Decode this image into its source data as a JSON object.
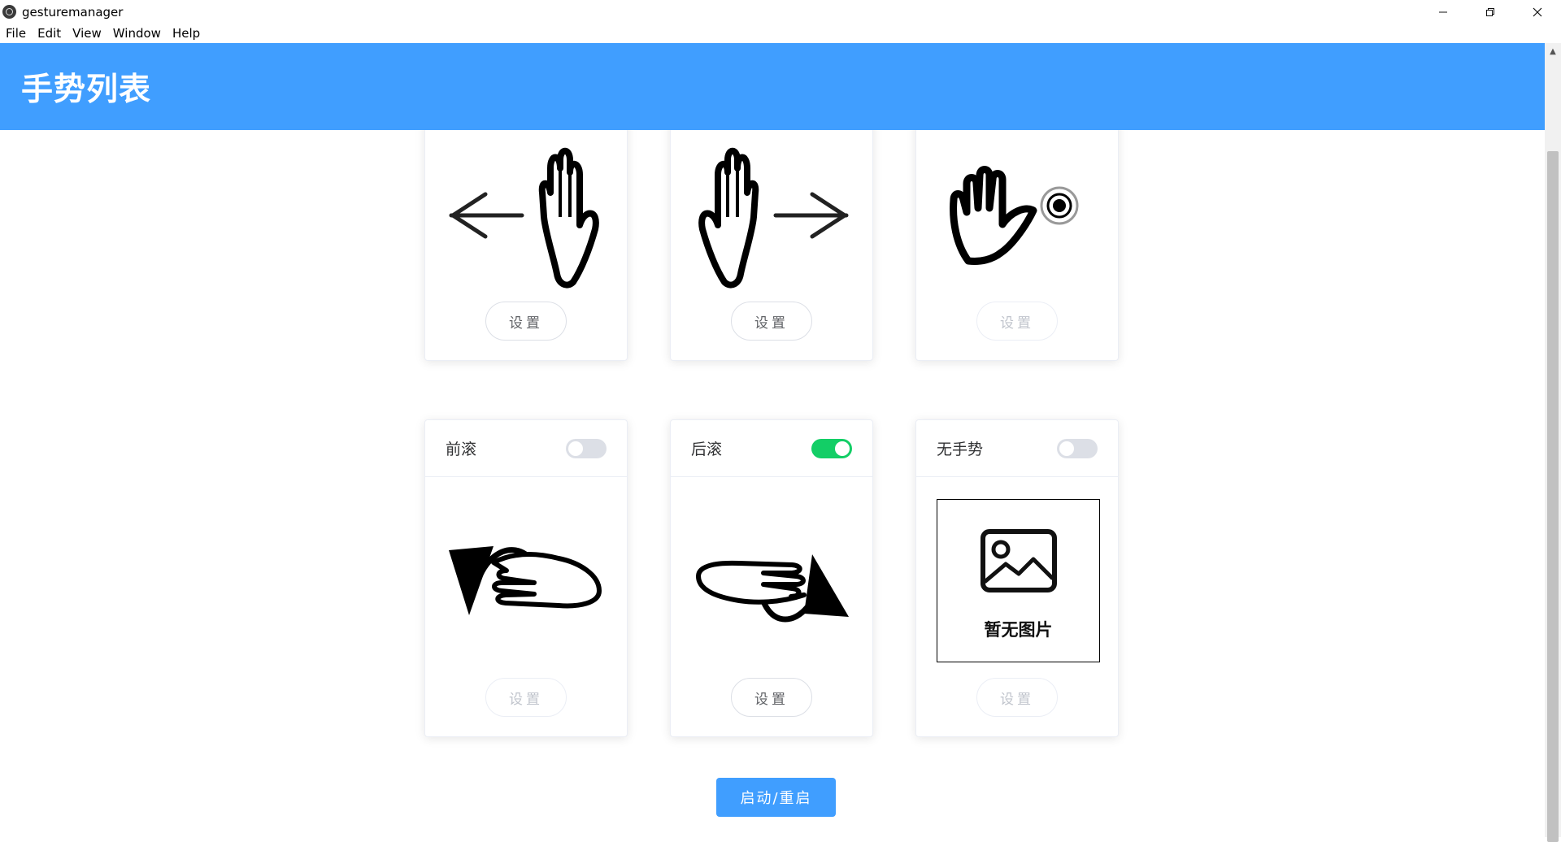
{
  "window": {
    "title": "gesturemanager",
    "controls": [
      "minimize-icon",
      "restore-icon",
      "close-icon"
    ]
  },
  "menu": [
    "File",
    "Edit",
    "View",
    "Window",
    "Help"
  ],
  "header": {
    "title": "手势列表"
  },
  "cards_top": [
    {
      "icon": "swipe-left-hand-icon",
      "button": "设置",
      "button_enabled": true
    },
    {
      "icon": "swipe-right-hand-icon",
      "button": "设置",
      "button_enabled": true
    },
    {
      "icon": "wave-hand-icon",
      "button": "设置",
      "button_enabled": false
    }
  ],
  "cards_bottom": [
    {
      "label": "前滚",
      "toggle_on": false,
      "icon": "roll-forward-hand-icon",
      "button": "设置",
      "button_enabled": false
    },
    {
      "label": "后滚",
      "toggle_on": true,
      "icon": "roll-backward-hand-icon",
      "button": "设置",
      "button_enabled": true
    },
    {
      "label": "无手势",
      "toggle_on": false,
      "icon": "no-image-icon",
      "placeholder_text": "暂无图片",
      "button": "设置",
      "button_enabled": false
    }
  ],
  "start_button": "启动/重启",
  "colors": {
    "header": "#409eff",
    "toggle_on": "#13ce66",
    "toggle_off": "#dcdfe6"
  }
}
